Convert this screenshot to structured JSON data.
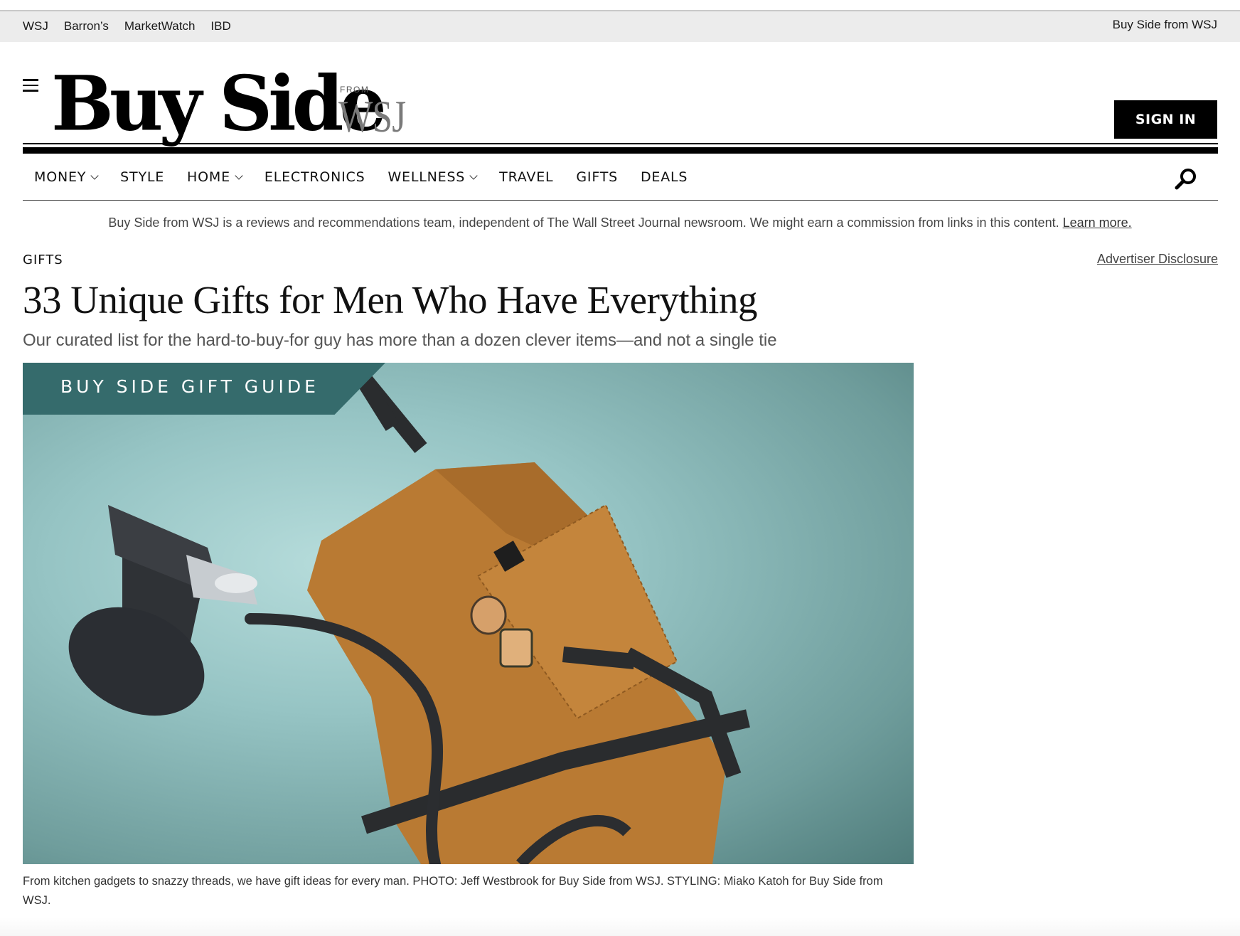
{
  "top_bar": {
    "sites": [
      "WSJ",
      "Barron’s",
      "MarketWatch",
      "IBD"
    ],
    "right_label": "Buy Side from WSJ"
  },
  "header": {
    "logo_main": "Buy Side",
    "logo_from": "FROM",
    "logo_wsj": "WSJ",
    "sign_in_label": "SIGN IN",
    "menu_icon": "hamburger-icon",
    "search_icon": "search-icon"
  },
  "nav": {
    "items": [
      {
        "label": "MONEY",
        "dropdown": true
      },
      {
        "label": "STYLE",
        "dropdown": false
      },
      {
        "label": "HOME",
        "dropdown": true
      },
      {
        "label": "ELECTRONICS",
        "dropdown": false
      },
      {
        "label": "WELLNESS",
        "dropdown": true
      },
      {
        "label": "TRAVEL",
        "dropdown": false
      },
      {
        "label": "GIFTS",
        "dropdown": false
      },
      {
        "label": "DEALS",
        "dropdown": false
      }
    ]
  },
  "disclaimer": {
    "text": "Buy Side from WSJ is a reviews and recommendations team, independent of The Wall Street Journal newsroom. We might earn a commission from links in this content.",
    "link": "Learn more."
  },
  "article": {
    "kicker": "GIFTS",
    "advertiser_disclosure": "Advertiser Disclosure",
    "headline": "33 Unique Gifts for Men Who Have Everything",
    "dek": "Our curated list for the hard-to-buy-for guy has more than a dozen clever items—and not a single tie",
    "hero_banner": "BUY SIDE GIFT GUIDE",
    "caption": "From kitchen gadgets to snazzy threads, we have gift ideas for every man. PHOTO: Jeff Westbrook for Buy Side from WSJ. STYLING: Miako Katoh for Buy Side from WSJ."
  },
  "colors": {
    "banner_teal": "#356b6c",
    "hero_background": "#96c4c4",
    "apron": "#b97a33",
    "button_black": "#000000"
  }
}
